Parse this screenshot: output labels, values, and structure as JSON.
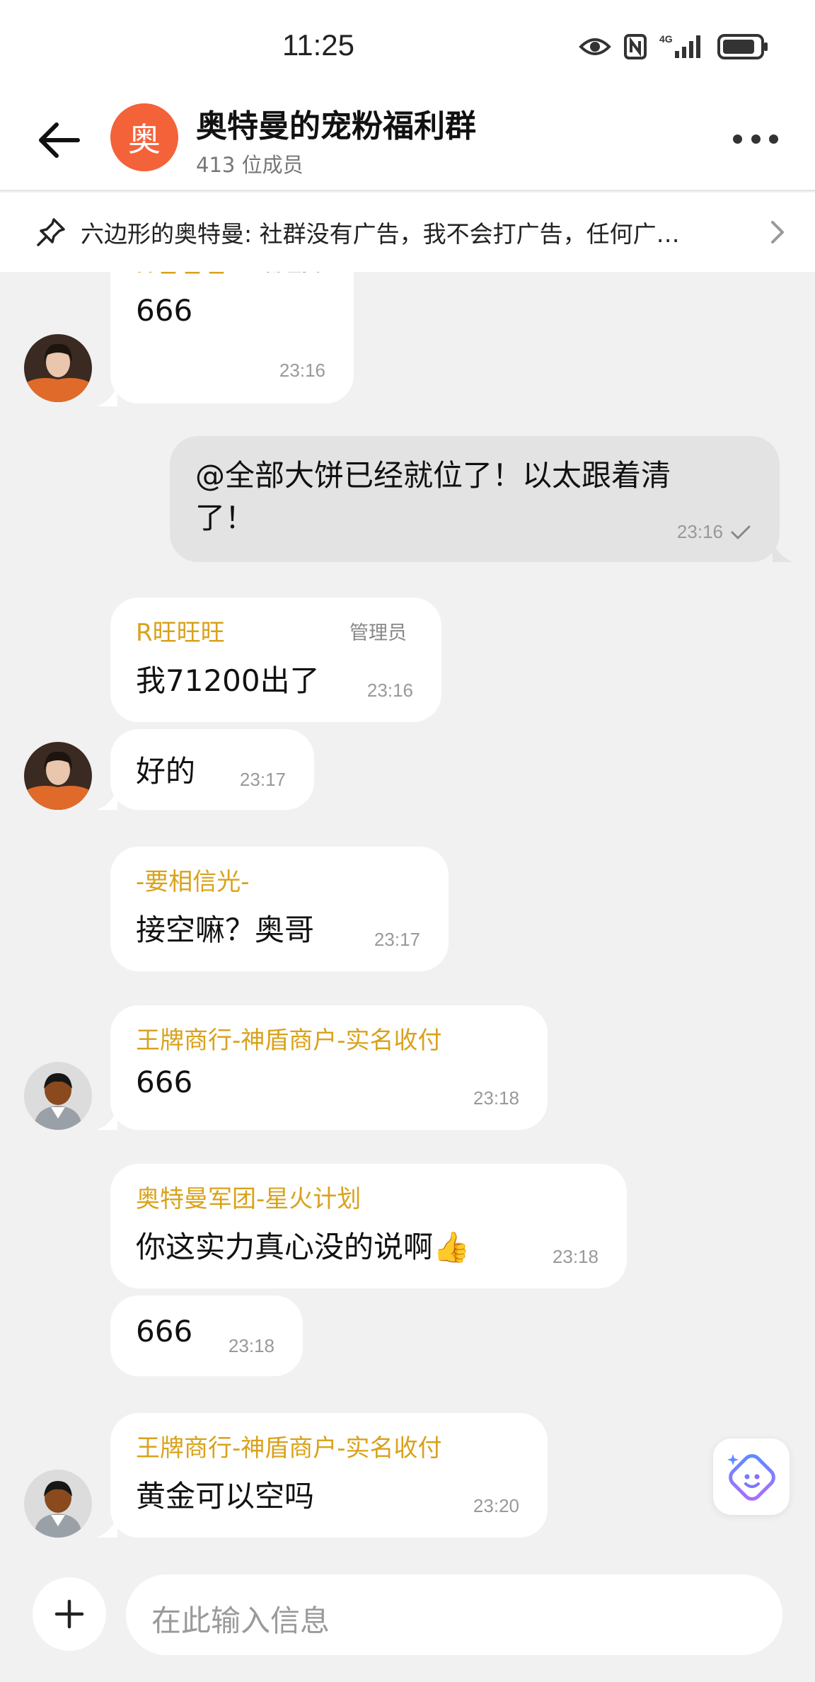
{
  "status_bar": {
    "time": "11:25",
    "network_label": "4G",
    "icons": [
      "eye-icon",
      "nfc-icon",
      "signal-4g-icon",
      "battery-icon"
    ]
  },
  "header": {
    "avatar_char": "奥",
    "group_name": "奥特曼的宠粉福利群",
    "member_count": "413 位成员",
    "avatar_color": "#f4623a"
  },
  "pinned": {
    "text": "六边形的奥特曼: 社群没有广告，我不会打广告，任何广…"
  },
  "messages": [
    {
      "sender": "R旺旺旺",
      "role": "管理员",
      "text": "666",
      "time": "23:16"
    },
    {
      "text_line1": "@全部大饼已经就位了！以太跟着清",
      "text_line2": "了！",
      "time": "23:16"
    },
    {
      "sender": "R旺旺旺",
      "role": "管理员",
      "text": "我71200出了",
      "time": "23:16"
    },
    {
      "text": "好的",
      "time": "23:17"
    },
    {
      "sender": "-要相信光-",
      "text": "接空嘛？奥哥",
      "time": "23:17"
    },
    {
      "sender": "王牌商行-神盾商户-实名收付",
      "text": "666",
      "time": "23:18"
    },
    {
      "sender": "奥特曼军团-星火计划",
      "text": "你这实力真心没的说啊👍",
      "time": "23:18"
    },
    {
      "text": "666",
      "time": "23:18"
    },
    {
      "sender": "王牌商行-神盾商户-实名收付",
      "text": "黄金可以空吗",
      "time": "23:20"
    }
  ],
  "input": {
    "placeholder": "在此输入信息"
  },
  "colors": {
    "accent_gold": "#d9a21b",
    "bubble_incoming": "#ffffff",
    "bubble_outgoing": "#e3e3e3",
    "background": "#f1f1f1"
  }
}
